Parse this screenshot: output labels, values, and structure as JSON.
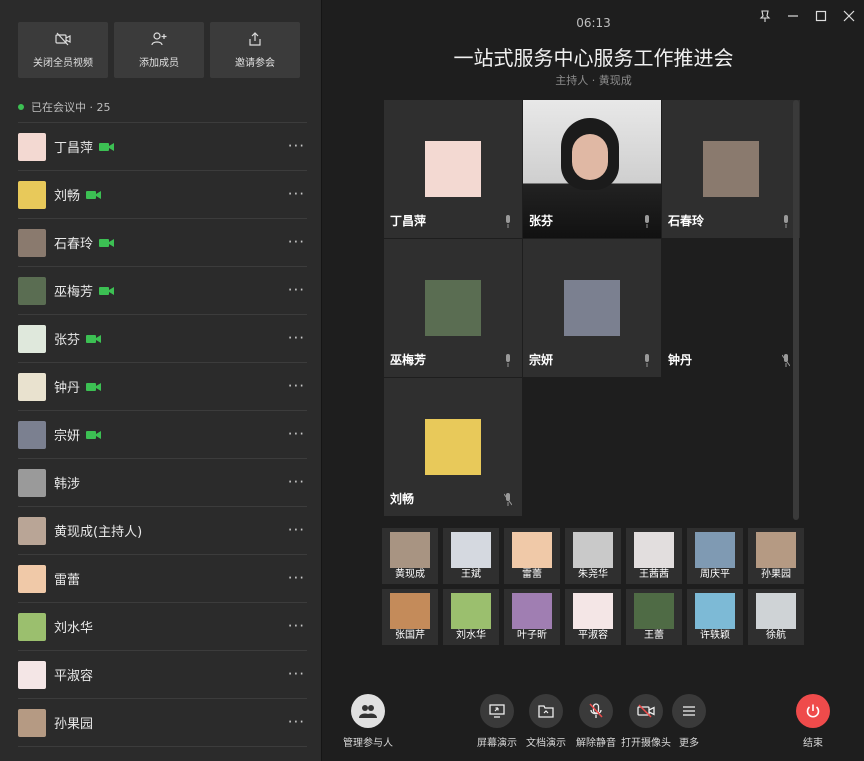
{
  "top_buttons": [
    {
      "label": "关闭全员视频",
      "icon": "camera-off-icon"
    },
    {
      "label": "添加成员",
      "icon": "add-user-icon"
    },
    {
      "label": "邀请参会",
      "icon": "share-icon"
    }
  ],
  "status": {
    "text": "已在会议中",
    "count": "25"
  },
  "participants": [
    {
      "name": "丁昌萍",
      "video": true,
      "avatar": "cartoon-girl",
      "color": "#f3d9d2"
    },
    {
      "name": "刘畅",
      "video": true,
      "avatar": "anime",
      "color": "#e8c95a"
    },
    {
      "name": "石春玲",
      "video": true,
      "avatar": "photo-woman",
      "color": "#8a7a6e"
    },
    {
      "name": "巫梅芳",
      "video": true,
      "avatar": "lotus",
      "color": "#5a6d52"
    },
    {
      "name": "张芬",
      "video": true,
      "avatar": "plant",
      "color": "#dfe8dc"
    },
    {
      "name": "钟丹",
      "video": true,
      "avatar": "flower",
      "color": "#e9e2cf"
    },
    {
      "name": "宗妍",
      "video": true,
      "avatar": "building",
      "color": "#7b8090"
    },
    {
      "name": "韩涉",
      "video": false,
      "avatar": "bw",
      "color": "#9a9a9a"
    },
    {
      "name": "黄现成(主持人)",
      "video": false,
      "avatar": "man",
      "color": "#b9a596"
    },
    {
      "name": "雷蕾",
      "video": false,
      "avatar": "cartoon",
      "color": "#f0c9a8"
    },
    {
      "name": "刘水华",
      "video": false,
      "avatar": "flowers",
      "color": "#9bbf6e"
    },
    {
      "name": "平淑容",
      "video": false,
      "avatar": "cartoon2",
      "color": "#f4e6e6"
    },
    {
      "name": "孙果园",
      "video": false,
      "avatar": "photo",
      "color": "#b59a83"
    }
  ],
  "clock": "06:13",
  "meeting": {
    "title": "一站式服务中心服务工作推进会",
    "host_label": "主持人 · 黄现成"
  },
  "tiles": [
    {
      "name": "丁昌萍",
      "col": 0,
      "row": 0,
      "kind": "avatar",
      "color": "#f3d9d2",
      "mic": "on"
    },
    {
      "name": "张芬",
      "col": 1,
      "row": 0,
      "kind": "video",
      "color": "#cfcfcf",
      "mic": "on"
    },
    {
      "name": "石春玲",
      "col": 2,
      "row": 0,
      "kind": "avatar",
      "color": "#8a7a6e",
      "mic": "on"
    },
    {
      "name": "巫梅芳",
      "col": 0,
      "row": 1,
      "kind": "avatar",
      "color": "#5a6d52",
      "mic": "on"
    },
    {
      "name": "宗妍",
      "col": 1,
      "row": 1,
      "kind": "avatar",
      "color": "#7b8090",
      "mic": "on"
    },
    {
      "name": "钟丹",
      "col": 2,
      "row": 1,
      "kind": "empty",
      "color": "",
      "mic": "muted"
    },
    {
      "name": "刘畅",
      "col": 0,
      "row": 2,
      "kind": "avatar",
      "color": "#e8c95a",
      "mic": "muted"
    }
  ],
  "thumb_rows": [
    [
      {
        "name": "黄现成",
        "color": "#a89482"
      },
      {
        "name": "王斌",
        "color": "#d5d9e0"
      },
      {
        "name": "雷蕾",
        "color": "#f0c9a8"
      },
      {
        "name": "朱尧华",
        "color": "#c9c9c9"
      },
      {
        "name": "王茜茜",
        "color": "#e2dede"
      },
      {
        "name": "周庆平",
        "color": "#7f9ab3"
      },
      {
        "name": "孙果园",
        "color": "#b59a83"
      }
    ],
    [
      {
        "name": "张国芹",
        "color": "#c48b5a"
      },
      {
        "name": "刘水华",
        "color": "#9bbf6e"
      },
      {
        "name": "叶子昕",
        "color": "#a07eb2"
      },
      {
        "name": "平淑容",
        "color": "#f4e6e6"
      },
      {
        "name": "王蕾",
        "color": "#4f6b45"
      },
      {
        "name": "许轶颖",
        "color": "#7dbad6"
      },
      {
        "name": "徐航",
        "color": "#cfd3d6"
      }
    ]
  ],
  "toolbar": {
    "manage": "管理参与人",
    "screen_share": "屏幕演示",
    "doc_share": "文档演示",
    "unmute": "解除静音",
    "camera": "打开摄像头",
    "more": "更多",
    "end": "结束"
  },
  "colors": {
    "accent_green": "#3cc053",
    "end_red": "#ef4b4b",
    "tile_bg": "#2f2f2f"
  }
}
